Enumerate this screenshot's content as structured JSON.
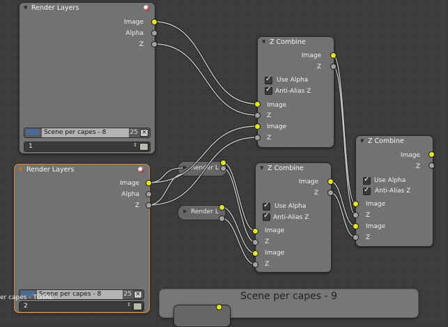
{
  "nodes": {
    "render_layers_1": {
      "title": "Render Layers",
      "outputs": [
        "Image",
        "Alpha",
        "Z"
      ],
      "scene_name": "Scene per capes - 8",
      "scene_users": "25",
      "layer_value": "1"
    },
    "render_layers_2": {
      "title": "Render Layers",
      "outputs": [
        "Image",
        "Alpha",
        "Z"
      ],
      "scene_name": "Scene per capes - 8",
      "scene_users": "25",
      "layer_value": "2"
    },
    "render_layers_collapsed_a": {
      "title": "Render L"
    },
    "render_layers_collapsed_b": {
      "title": "Render L"
    },
    "z_combine_1": {
      "title": "Z Combine",
      "outputs": [
        "Image",
        "Z"
      ],
      "use_alpha": "Use Alpha",
      "anti_alias": "Anti-Alias Z",
      "inputs": [
        "Image",
        "Z",
        "Image",
        "Z"
      ]
    },
    "z_combine_2": {
      "title": "Z Combine",
      "outputs": [
        "Image",
        "Z"
      ],
      "use_alpha": "Use Alpha",
      "anti_alias": "Anti-Alias Z",
      "inputs": [
        "Image",
        "Z",
        "Image",
        "Z"
      ]
    },
    "z_combine_3": {
      "title": "Z Combine",
      "outputs": [
        "Image",
        "Z"
      ],
      "use_alpha": "Use Alpha",
      "anti_alias": "Anti-Alias Z",
      "inputs": [
        "Image",
        "Z",
        "Image",
        "Z"
      ]
    }
  },
  "frame": {
    "title": "Scene per capes - 9"
  },
  "status": {
    "text": "er capes - TOTAL"
  },
  "colors": {
    "image_socket": "#e6e61c",
    "value_socket": "#a2a2a2",
    "active_border": "#e58a2a"
  }
}
